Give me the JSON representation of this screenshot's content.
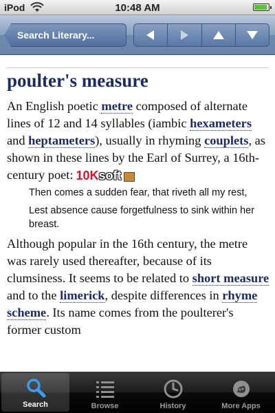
{
  "status_bar": {
    "carrier": "iPod",
    "time": "10:48 AM",
    "battery_level": 0.9
  },
  "nav_bar": {
    "search_label": "Search Literary...",
    "buttons": [
      "back-arrow-icon",
      "forward-arrow-icon",
      "up-arrow-icon",
      "down-arrow-icon"
    ]
  },
  "entry": {
    "title": "poulter's measure",
    "p1": {
      "t1": "An English poetic ",
      "l1": "metre",
      "t2": " composed of alternate lines of 12 and 14 syllables (iambic ",
      "l2": "hexameters",
      "t3": " and ",
      "l3": "heptameters",
      "t4": "), usually in rhyming ",
      "l4": "couplets",
      "t5": ", as shown in these lines by the Earl of Surrey, a 16th-century poet:"
    },
    "quote": [
      "Then comes a sudden fear, that riveth all my rest,",
      "Lest absence cause forgetfulness to sink within her breast."
    ],
    "p2": {
      "t1": "Although popular in the 16th century, the metre was rarely used thereafter, because of its clumsiness. It seems to be related to ",
      "l1": "short measure",
      "t2": " and to the ",
      "l2": "limerick",
      "t3": ", despite differences in ",
      "l3": "rhyme scheme",
      "t4": ". Its name comes from the poulterer's former custom"
    }
  },
  "watermark": {
    "part1": "10K",
    "part2": "soft"
  },
  "tabs": [
    {
      "label": "Search",
      "icon": "search-icon",
      "active": true
    },
    {
      "label": "Browse",
      "icon": "browse-list-icon",
      "active": false
    },
    {
      "label": "History",
      "icon": "history-clock-icon",
      "active": false
    },
    {
      "label": "More Apps",
      "icon": "more-apps-icon",
      "active": false
    }
  ],
  "colors": {
    "nav": "#7b93b8",
    "link": "#1c2b66",
    "tab_bar": "#111111"
  }
}
